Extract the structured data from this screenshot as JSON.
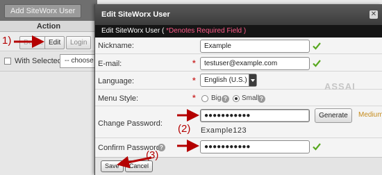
{
  "background": {
    "add_button": "Add SiteWorx User",
    "action_header": "Action",
    "delete_label": "Delete",
    "edit_label": "Edit",
    "login_label": "Login",
    "with_selected_label": "With Selected:",
    "choose_placeholder": "-- choose --"
  },
  "dialog": {
    "title": "Edit SiteWorx User",
    "subtitle_prefix": "Edit SiteWorx User (",
    "required_note": " *Denotes Required Field )",
    "fields": {
      "nickname": {
        "label": "Nickname:",
        "value": "Example"
      },
      "email": {
        "label": "E-mail:",
        "value": "testuser@example.com"
      },
      "language": {
        "label": "Language:",
        "value": "English (U.S.)"
      },
      "menu_style": {
        "label": "Menu Style:",
        "option_big": "Big",
        "option_small": "Small",
        "selected": "Small"
      },
      "change_password": {
        "label": "Change Password:",
        "value": "●●●●●●●●●●●",
        "generated": "Example123",
        "strength": "Medium"
      },
      "confirm_password": {
        "label": "Confirm Password:",
        "value": "●●●●●●●●●●●"
      }
    },
    "generate_label": "Generate",
    "save_label": "Save",
    "cancel_label": "Cancel",
    "required_marker": "*"
  },
  "watermark": {
    "line1": "ASSAI"
  },
  "annotations": {
    "step1": "1)",
    "step2": "(2)",
    "step3": "(3)",
    "arrow_color": "#b40000"
  }
}
